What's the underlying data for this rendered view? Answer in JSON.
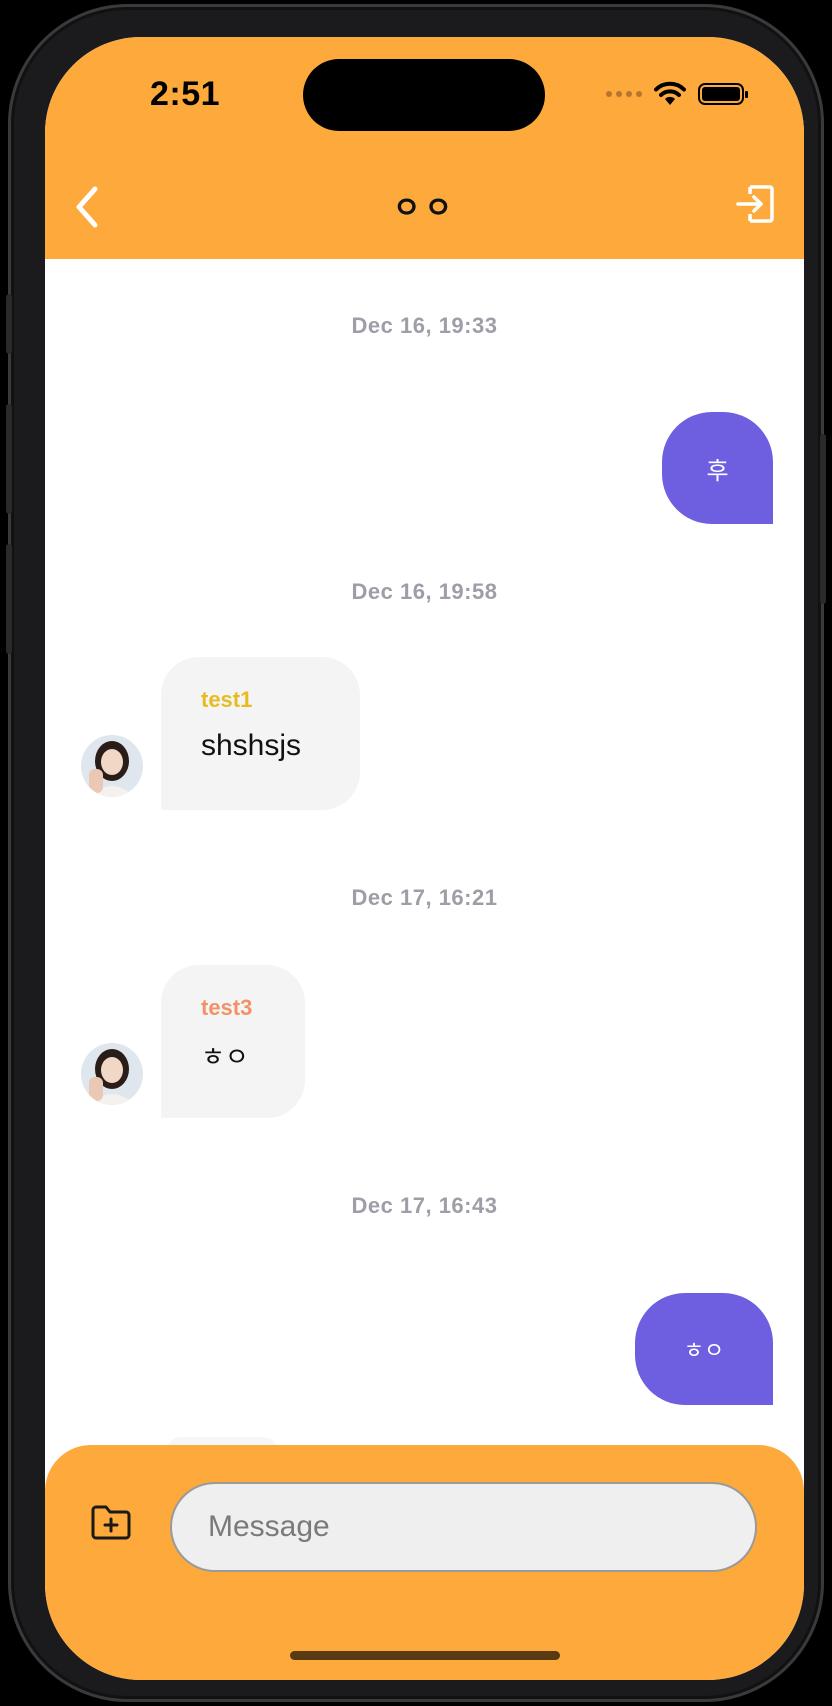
{
  "status_bar": {
    "time": "2:51"
  },
  "header": {
    "title": "ㅇㅇ"
  },
  "messages": [
    {
      "date": "Dec 16, 19:33",
      "direction": "out",
      "text": "후"
    },
    {
      "date": "Dec 16, 19:58",
      "direction": "in",
      "sender": "test1",
      "sender_color": "#E7BC23",
      "text": "shshsjs"
    },
    {
      "date": "Dec 17, 16:21",
      "direction": "in",
      "sender": "test3",
      "sender_color": "#F29269",
      "text": "ㅎㅇ"
    },
    {
      "date": "Dec 17, 16:43",
      "direction": "out",
      "text": "ㅎㅇ"
    }
  ],
  "composer": {
    "placeholder": "Message"
  },
  "colors": {
    "accent": "#FDA93C",
    "outgoing_bubble": "#6E5FE0",
    "incoming_bubble": "#F4F4F4",
    "date_text": "#9E9EA8"
  },
  "icons": {
    "back": "chevron-left-icon",
    "exit": "exit-icon",
    "attach": "folder-plus-icon"
  }
}
